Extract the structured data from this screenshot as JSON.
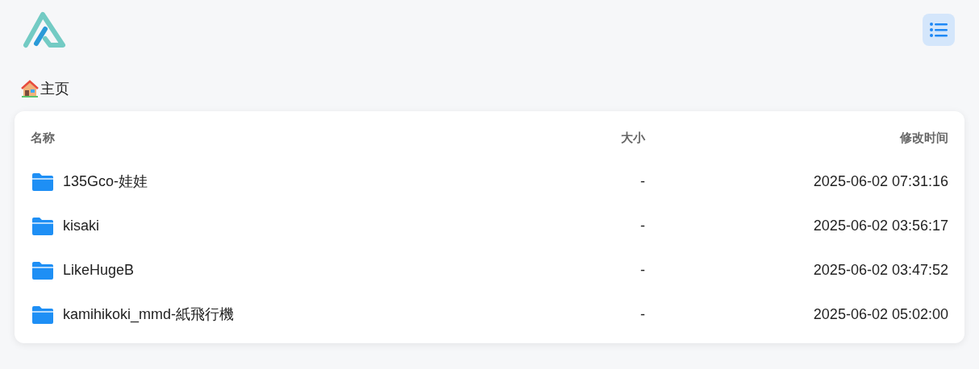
{
  "breadcrumb": {
    "label": "主页"
  },
  "table": {
    "columns": [
      "名称",
      "大小",
      "修改时间"
    ],
    "rows": [
      {
        "kind": "folder",
        "name": "135Gco-娃娃",
        "size": "-",
        "modified": "2025-06-02 07:31:16"
      },
      {
        "kind": "folder",
        "name": "kisaki",
        "size": "-",
        "modified": "2025-06-02 03:56:17"
      },
      {
        "kind": "folder",
        "name": "LikeHugeB",
        "size": "-",
        "modified": "2025-06-02 03:47:52"
      },
      {
        "kind": "folder",
        "name": "kamihikoki_mmd-紙飛行機",
        "size": "-",
        "modified": "2025-06-02 05:02:00"
      }
    ]
  }
}
